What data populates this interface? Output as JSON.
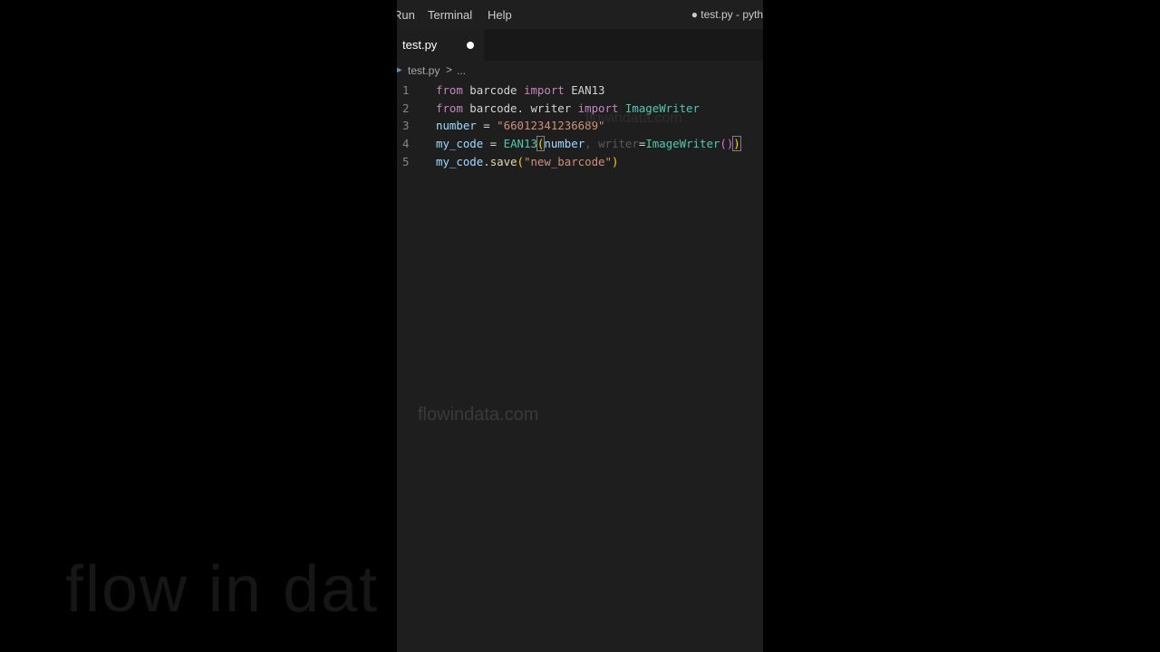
{
  "menu": {
    "run": "Run",
    "terminal": "Terminal",
    "help": "Help"
  },
  "window_title": "● test.py - pyth",
  "tab": {
    "label": "test.py"
  },
  "breadcrumb": {
    "file": "test.py",
    "sep": ">",
    "more": "..."
  },
  "editor": {
    "line_numbers": [
      "1",
      "2",
      "3",
      "4",
      "5"
    ],
    "lines": {
      "l1": {
        "from": "from",
        "module": " barcode ",
        "import": "import",
        "name": " EAN13"
      },
      "l2": {
        "from": "from",
        "module": " barcode. writer ",
        "import": "import",
        "name": " ImageWriter"
      },
      "l3": {
        "var": "number",
        "eq": " = ",
        "str": "\"66012341236689\""
      },
      "l4": {
        "var": "my_code",
        "eq": " = ",
        "cls": "EAN13",
        "open": "(",
        "arg": "number",
        "comma": ", ",
        "kw": "writer",
        "assign": "=",
        "cls2": "ImageWriter",
        "call": "()",
        "close": ")"
      },
      "l5": {
        "var": "my_code",
        "dot": ".",
        "fn": "save",
        "open": "(",
        "str": "\"new_barcode\"",
        "close": ")"
      }
    }
  },
  "watermark": "flowindata.com",
  "watermark_bg": "flow in dat",
  "colors": {
    "keyword": "#c586c0",
    "class": "#4ec9b0",
    "variable": "#9cdcfe",
    "string": "#ce9178",
    "function": "#dcdcaa",
    "editor_bg": "#1e1e1e"
  }
}
